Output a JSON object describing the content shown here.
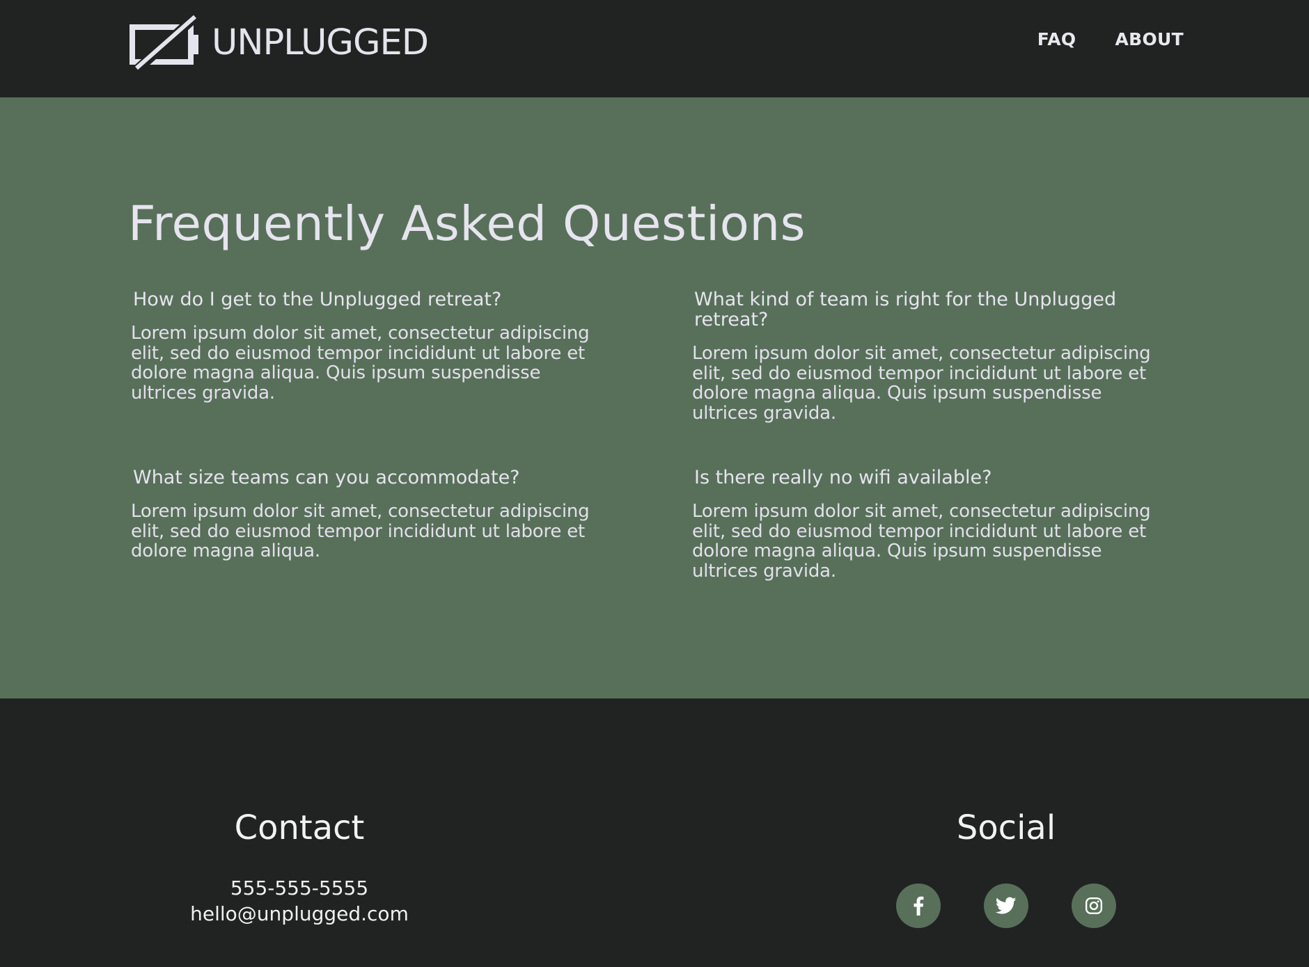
{
  "header": {
    "logo_text": "UNPLUGGED",
    "nav": [
      {
        "label": "FAQ"
      },
      {
        "label": "ABOUT"
      }
    ]
  },
  "faq": {
    "title": "Frequently Asked Questions",
    "items": [
      {
        "question": "How do I get to the Unplugged retreat?",
        "answer": "Lorem ipsum dolor sit amet, consectetur adipiscing elit, sed do eiusmod tempor incididunt ut labore et dolore magna aliqua. Quis ipsum suspendisse ultrices gravida."
      },
      {
        "question": "What kind of team is right for the Unplugged retreat?",
        "answer": "Lorem ipsum dolor sit amet, consectetur adipiscing elit, sed do eiusmod tempor incididunt ut labore et dolore magna aliqua. Quis ipsum suspendisse ultrices gravida."
      },
      {
        "question": "What size teams can you accommodate?",
        "answer": "Lorem ipsum dolor sit amet, consectetur adipiscing elit, sed do eiusmod tempor incididunt ut labore et dolore magna aliqua."
      },
      {
        "question": "Is there really no wifi available?",
        "answer": "Lorem ipsum dolor sit amet, consectetur adipiscing elit, sed do eiusmod tempor incididunt ut labore et dolore magna aliqua. Quis ipsum suspendisse ultrices gravida."
      }
    ]
  },
  "footer": {
    "contact": {
      "heading": "Contact",
      "phone": "555-555-5555",
      "email": "hello@unplugged.com"
    },
    "social": {
      "heading": "Social",
      "icons": [
        "facebook-icon",
        "twitter-icon",
        "instagram-icon"
      ]
    }
  },
  "colors": {
    "dark": "#212322",
    "green": "#58705a",
    "text_light": "#e6e4ee"
  }
}
